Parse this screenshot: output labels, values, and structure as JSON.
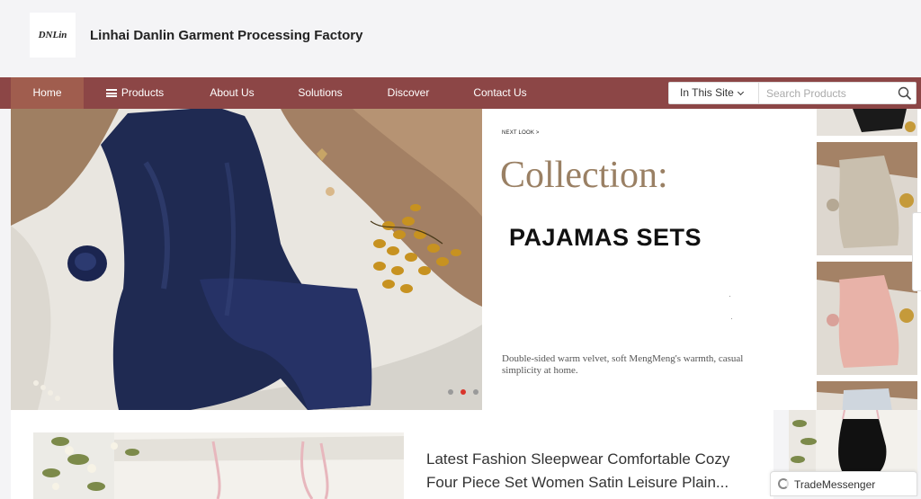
{
  "header": {
    "logo_text": "DNLin",
    "company_name": "Linhai Danlin Garment Processing Factory"
  },
  "nav": {
    "items": [
      {
        "label": "Home",
        "active": true
      },
      {
        "label": "Products"
      },
      {
        "label": "About Us"
      },
      {
        "label": "Solutions"
      },
      {
        "label": "Discover"
      },
      {
        "label": "Contact Us"
      }
    ],
    "color": "#8c4646",
    "active_color": "#a05d4e"
  },
  "search": {
    "scope": "In This Site",
    "placeholder": "Search Products",
    "icon": "search-icon"
  },
  "banner": {
    "next_look": "NEXT LOOK >",
    "collection": "Collection:",
    "headline": "PAJAMAS SETS",
    "description": "Double-sided warm velvet, soft MengMeng's warmth, casual simplicity at home.",
    "slide_count": 3,
    "active_slide": 2
  },
  "featured": {
    "title": "Latest Fashion Sleepwear Comfortable Cozy Four Piece Set Women Satin Leisure Plain..."
  },
  "messenger": {
    "label": "TradeMessenger",
    "icon": "spinner-icon"
  }
}
